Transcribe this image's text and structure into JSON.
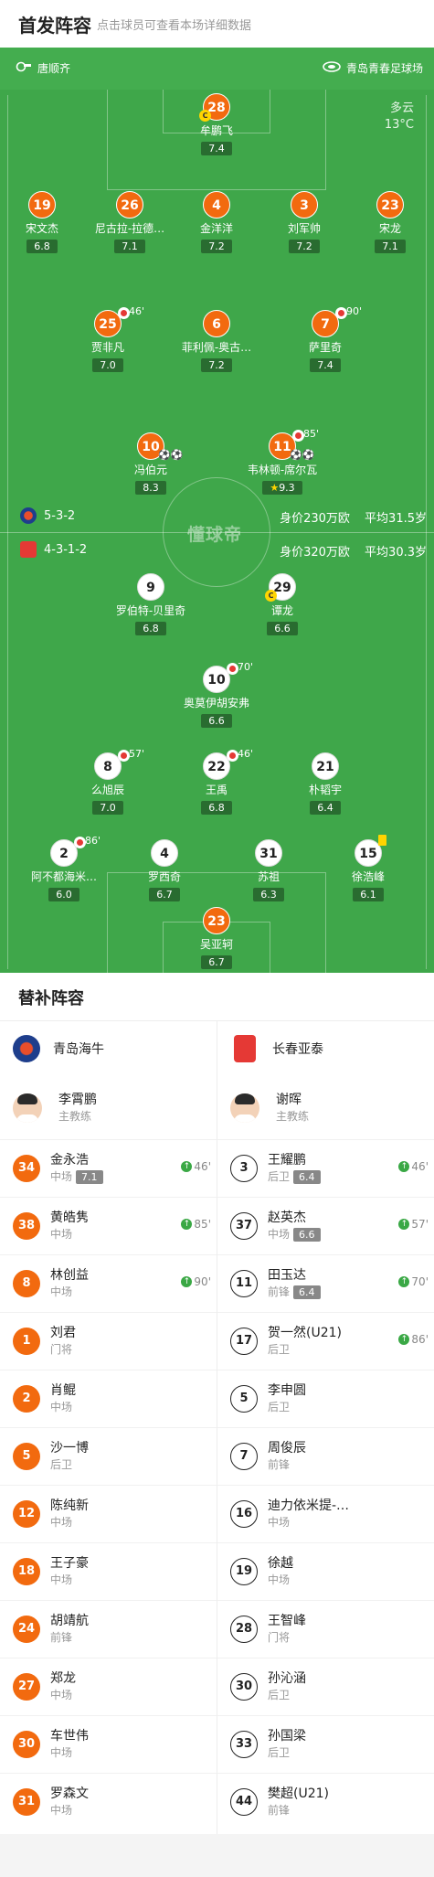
{
  "header": {
    "title": "首发阵容",
    "subtitle": "点击球员可查看本场详细数据"
  },
  "venue": {
    "referee": "唐顺齐",
    "stadium": "青岛青春足球场",
    "weather": "多云",
    "temperature": "13°C"
  },
  "watermark": "懂球帝",
  "home": {
    "formation": "5-3-2",
    "value": "身价230万欧",
    "avg_age": "平均31.5岁",
    "color": "#f26a0f",
    "players": [
      {
        "num": "28",
        "name": "牟鹏飞",
        "rating": "7.4",
        "captain": true
      },
      {
        "num": "19",
        "name": "宋文杰",
        "rating": "6.8"
      },
      {
        "num": "26",
        "name": "尼古拉-拉德…",
        "rating": "7.1"
      },
      {
        "num": "4",
        "name": "金洋洋",
        "rating": "7.2"
      },
      {
        "num": "3",
        "name": "刘军帅",
        "rating": "7.2"
      },
      {
        "num": "23",
        "name": "宋龙",
        "rating": "7.1"
      },
      {
        "num": "25",
        "name": "贾非凡",
        "rating": "7.0",
        "sub_min": "46'"
      },
      {
        "num": "6",
        "name": "菲利佩-奥古…",
        "rating": "7.2"
      },
      {
        "num": "7",
        "name": "萨里奇",
        "rating": "7.4",
        "sub_min": "90'"
      },
      {
        "num": "10",
        "name": "冯伯元",
        "rating": "8.3",
        "events": "⚽⚽"
      },
      {
        "num": "11",
        "name": "韦林顿-席尔瓦",
        "rating": "9.3",
        "sub_min": "85'",
        "events": "⚽⚽",
        "mvp": true
      }
    ]
  },
  "away": {
    "formation": "4-3-1-2",
    "value": "身价320万欧",
    "avg_age": "平均30.3岁",
    "color": "#e53935",
    "players": [
      {
        "num": "9",
        "name": "罗伯特-贝里奇",
        "rating": "6.8"
      },
      {
        "num": "29",
        "name": "谭龙",
        "rating": "6.6",
        "captain": true
      },
      {
        "num": "10",
        "name": "奥莫伊胡安弗",
        "rating": "6.6",
        "sub_min": "70'"
      },
      {
        "num": "8",
        "name": "么旭辰",
        "rating": "7.0",
        "sub_min": "57'"
      },
      {
        "num": "22",
        "name": "王禹",
        "rating": "6.8",
        "sub_min": "46'"
      },
      {
        "num": "21",
        "name": "朴韬宇",
        "rating": "6.4"
      },
      {
        "num": "2",
        "name": "阿不都海米…",
        "rating": "6.0",
        "sub_min": "86'"
      },
      {
        "num": "4",
        "name": "罗西奇",
        "rating": "6.7"
      },
      {
        "num": "31",
        "name": "苏祖",
        "rating": "6.3"
      },
      {
        "num": "15",
        "name": "徐浩峰",
        "rating": "6.1",
        "yellow": true
      },
      {
        "num": "23",
        "name": "吴亚轲",
        "rating": "6.7"
      }
    ]
  },
  "subs": {
    "title": "替补阵容",
    "left": {
      "team": "青岛海牛",
      "coach": "李霄鹏",
      "coach_role": "主教练",
      "players": [
        {
          "num": "34",
          "name": "金永浩",
          "pos": "中场",
          "rating": "7.1",
          "min": "46'"
        },
        {
          "num": "38",
          "name": "黄皓隽",
          "pos": "中场",
          "min": "85'"
        },
        {
          "num": "8",
          "name": "林创益",
          "pos": "中场",
          "min": "90'"
        },
        {
          "num": "1",
          "name": "刘君",
          "pos": "门将"
        },
        {
          "num": "2",
          "name": "肖鲲",
          "pos": "中场"
        },
        {
          "num": "5",
          "name": "沙一博",
          "pos": "后卫"
        },
        {
          "num": "12",
          "name": "陈纯新",
          "pos": "中场"
        },
        {
          "num": "18",
          "name": "王子豪",
          "pos": "中场"
        },
        {
          "num": "24",
          "name": "胡靖航",
          "pos": "前锋"
        },
        {
          "num": "27",
          "name": "郑龙",
          "pos": "中场"
        },
        {
          "num": "30",
          "name": "车世伟",
          "pos": "中场"
        },
        {
          "num": "31",
          "name": "罗森文",
          "pos": "中场"
        }
      ]
    },
    "right": {
      "team": "长春亚泰",
      "coach": "谢晖",
      "coach_role": "主教练",
      "players": [
        {
          "num": "3",
          "name": "王耀鹏",
          "pos": "后卫",
          "rating": "6.4",
          "min": "46'"
        },
        {
          "num": "37",
          "name": "赵英杰",
          "pos": "中场",
          "rating": "6.6",
          "min": "57'"
        },
        {
          "num": "11",
          "name": "田玉达",
          "pos": "前锋",
          "rating": "6.4",
          "min": "70'"
        },
        {
          "num": "17",
          "name": "贺一然(U21)",
          "pos": "后卫",
          "min": "86'"
        },
        {
          "num": "5",
          "name": "李申圆",
          "pos": "后卫"
        },
        {
          "num": "7",
          "name": "周俊辰",
          "pos": "前锋"
        },
        {
          "num": "16",
          "name": "迪力依米提-…",
          "pos": "中场"
        },
        {
          "num": "19",
          "name": "徐越",
          "pos": "中场"
        },
        {
          "num": "28",
          "name": "王智峰",
          "pos": "门将"
        },
        {
          "num": "30",
          "name": "孙沁涵",
          "pos": "后卫"
        },
        {
          "num": "33",
          "name": "孙国梁",
          "pos": "后卫"
        },
        {
          "num": "44",
          "name": "樊超(U21)",
          "pos": "前锋"
        }
      ]
    }
  }
}
